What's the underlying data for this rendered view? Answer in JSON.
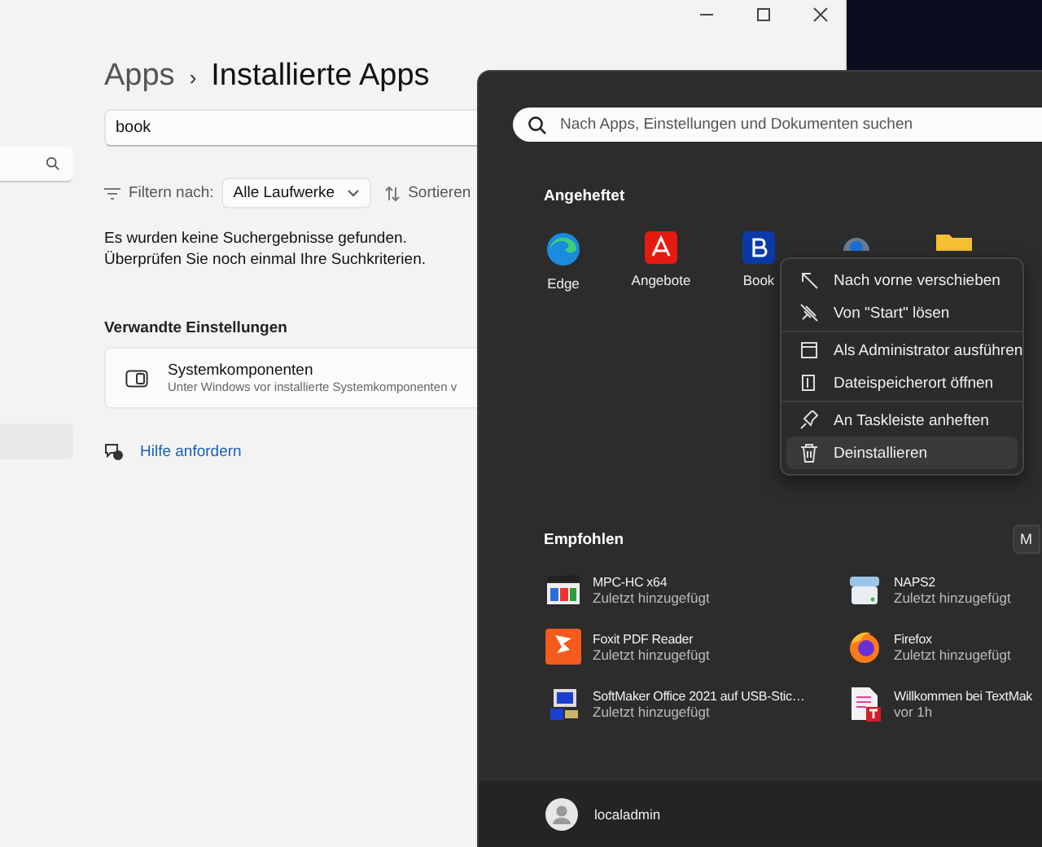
{
  "settings": {
    "breadcrumb_parent": "Apps",
    "breadcrumb_separator": "›",
    "title": "Installierte Apps",
    "search": {
      "value": "book"
    },
    "filter": {
      "label": "Filtern nach:",
      "value": "Alle Laufwerke"
    },
    "sort": {
      "label": "Sortieren"
    },
    "message": [
      "Es wurden keine Suchergebnisse gefunden.",
      "Überprüfen Sie noch einmal Ihre Suchkriterien."
    ],
    "related_heading": "Verwandte Einstellungen",
    "related_card": {
      "title": "Systemkomponenten",
      "subtitle": "Unter Windows vor installierte Systemkomponenten v"
    },
    "help_link": "Hilfe anfordern"
  },
  "start_menu": {
    "search": {
      "placeholder": "Nach Apps, Einstellungen und Dokumenten suchen"
    },
    "pinned_heading": "Angeheftet",
    "pinned": [
      {
        "kind": "app",
        "label": "Edge"
      },
      {
        "kind": "app",
        "label": "Angebote"
      },
      {
        "kind": "app",
        "label": "Book"
      },
      {
        "kind": "covered"
      },
      {
        "kind": "covered"
      }
    ],
    "context_menu": [
      {
        "items": [
          {
            "label": "Nach vorne verschieben",
            "selected": false
          },
          {
            "label": "Von \"Start\" lösen",
            "selected": false
          }
        ]
      },
      {
        "items": [
          {
            "label": "Als Administrator ausführen",
            "selected": false
          },
          {
            "label": "Dateispeicherort öffnen",
            "selected": false
          }
        ]
      },
      {
        "items": [
          {
            "label": "An Taskleiste anheften",
            "selected": false
          },
          {
            "label": "Deinstallieren",
            "selected": true
          }
        ]
      }
    ],
    "recommended_heading": "Empfohlen",
    "more_button": "M",
    "recommended": [
      {
        "name": "MPC-HC x64",
        "detail": "Zuletzt hinzugefügt"
      },
      {
        "name": "NAPS2",
        "detail": "Zuletzt hinzugefügt"
      },
      {
        "name": "Foxit PDF Reader",
        "detail": "Zuletzt hinzugefügt"
      },
      {
        "name": "Firefox",
        "detail": "Zuletzt hinzugefügt"
      },
      {
        "name": "SoftMaker Office 2021 auf USB-Stic…",
        "detail": "Zuletzt hinzugefügt"
      },
      {
        "name": "Willkommen bei TextMak",
        "detail": "vor 1h"
      }
    ],
    "user": "localadmin"
  }
}
